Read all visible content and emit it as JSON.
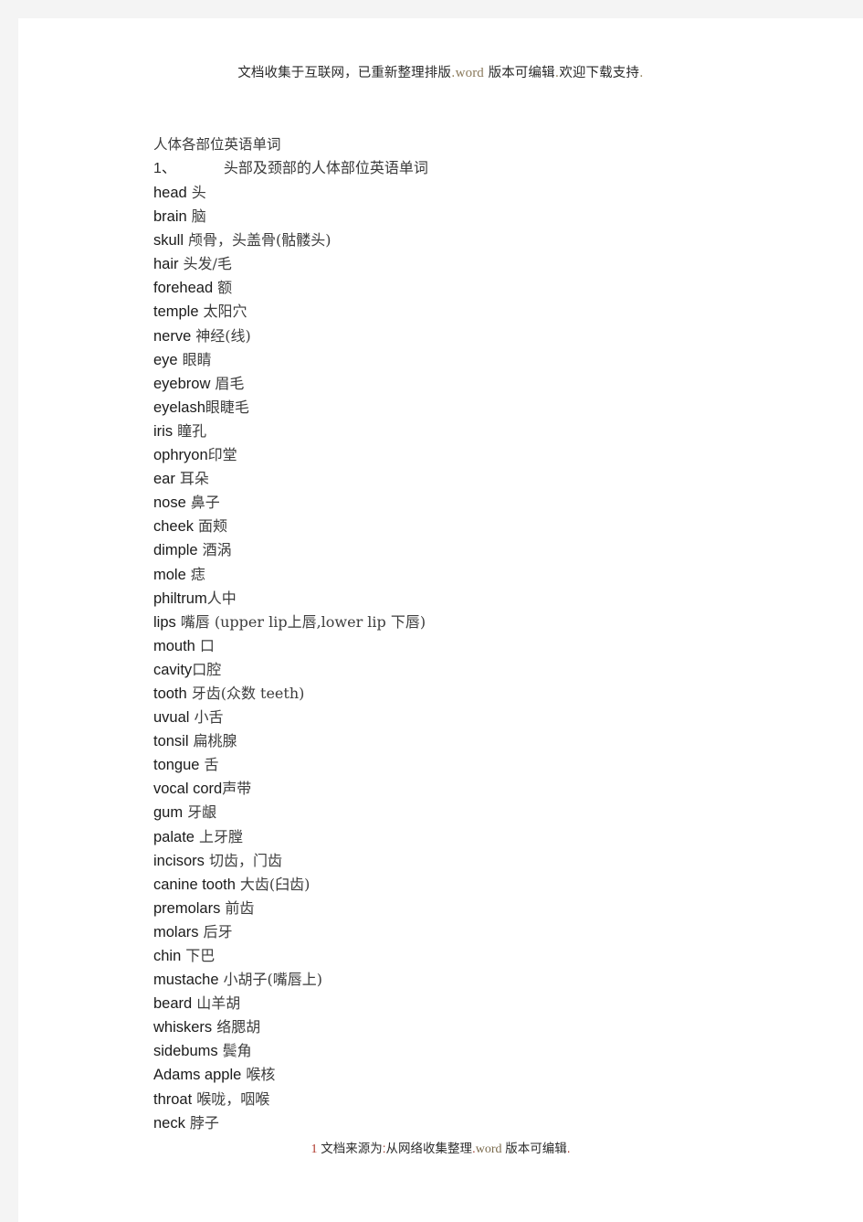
{
  "header": {
    "text_part1": "文档收集于互联网，已重新整理排版",
    "dot1": ".",
    "word": "word",
    "text_part2": "版本可编辑",
    "dot2": ".",
    "text_part3": "欢迎下载支持",
    "dot3": "."
  },
  "document": {
    "title": "人体各部位英语单词",
    "section_number": "1、",
    "section_title": "头部及颈部的人体部位英语单词",
    "entries": [
      {
        "en": "head",
        "cn": "头"
      },
      {
        "en": "brain",
        "cn": "脑"
      },
      {
        "en": "skull",
        "cn": "颅骨，头盖骨(骷髅头)"
      },
      {
        "en": "hair",
        "cn": "头发/毛"
      },
      {
        "en": "forehead",
        "cn": "额"
      },
      {
        "en": "temple",
        "cn": "太阳穴"
      },
      {
        "en": "nerve",
        "cn": "神经(线)"
      },
      {
        "en": "eye",
        "cn": "眼睛"
      },
      {
        "en": "eyebrow",
        "cn": "眉毛"
      },
      {
        "en": "eyelash",
        "cn": "眼睫毛",
        "tight": true
      },
      {
        "en": "iris",
        "cn": "瞳孔"
      },
      {
        "en": "ophryon",
        "cn": "印堂",
        "tight": true
      },
      {
        "en": "ear",
        "cn": "耳朵"
      },
      {
        "en": "nose",
        "cn": "鼻子"
      },
      {
        "en": "cheek",
        "cn": "面颊"
      },
      {
        "en": "dimple",
        "cn": "酒涡"
      },
      {
        "en": "mole",
        "cn": "痣"
      },
      {
        "en": "philtrum",
        "cn": "人中",
        "tight": true
      },
      {
        "en": "lips",
        "cn": "嘴唇 (upper lip上唇,lower lip 下唇)"
      },
      {
        "en": "mouth",
        "cn": "口"
      },
      {
        "en": "cavity",
        "cn": "口腔",
        "tight": true
      },
      {
        "en": "tooth",
        "cn": "牙齿(众数 teeth)"
      },
      {
        "en": "uvual",
        "cn": "小舌"
      },
      {
        "en": "tonsil",
        "cn": "扁桃腺"
      },
      {
        "en": "tongue",
        "cn": "舌"
      },
      {
        "en": "vocal cord",
        "cn": "声带",
        "tight": true
      },
      {
        "en": "gum",
        "cn": "牙龈"
      },
      {
        "en": "palate",
        "cn": "上牙膛"
      },
      {
        "en": "incisors",
        "cn": "切齿，门齿"
      },
      {
        "en": "canine tooth",
        "cn": "大齿(臼齿)"
      },
      {
        "en": "premolars",
        "cn": "前齿"
      },
      {
        "en": "molars",
        "cn": "后牙"
      },
      {
        "en": "chin",
        "cn": "下巴"
      },
      {
        "en": "mustache",
        "cn": "小胡子(嘴唇上)"
      },
      {
        "en": "beard",
        "cn": "山羊胡"
      },
      {
        "en": "whiskers",
        "cn": "络腮胡"
      },
      {
        "en": "sidebums",
        "cn": "鬓角"
      },
      {
        "en": "Adams apple",
        "cn": "喉核"
      },
      {
        "en": "throat",
        "cn": "喉咙，咽喉"
      },
      {
        "en": "neck",
        "cn": "脖子"
      }
    ]
  },
  "footer": {
    "page_number": "1",
    "text_part1": "文档来源为",
    "colon": ":",
    "text_part2": "从网络收集整理",
    "dot1": ".",
    "word": "word",
    "text_part3": "版本可编辑",
    "dot2": "."
  }
}
